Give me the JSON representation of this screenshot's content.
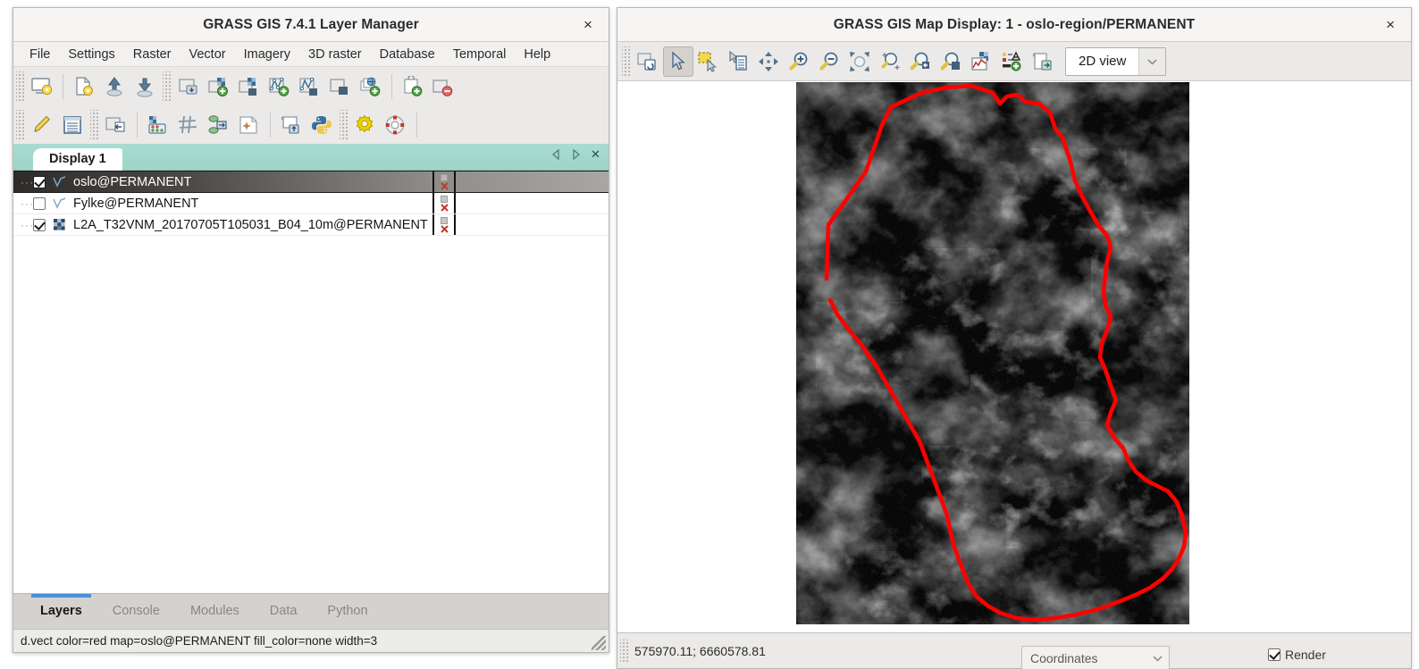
{
  "layer_manager": {
    "title": "GRASS GIS 7.4.1 Layer Manager",
    "close_label": "×",
    "menu": [
      "File",
      "Settings",
      "Raster",
      "Vector",
      "Imagery",
      "3D raster",
      "Database",
      "Temporal",
      "Help"
    ],
    "toolbar_row1": [
      {
        "name": "start-new-map-display-icon",
        "tip": "Start new map display"
      },
      {
        "name": "create-new-workspace-icon",
        "tip": "Create new workspace"
      },
      {
        "name": "open-existing-workspace-icon",
        "tip": "Open existing workspace file"
      },
      {
        "name": "save-workspace-icon",
        "tip": "Save current workspace to file"
      },
      {
        "name": "import-raster-data-icon",
        "tip": "Import raster data"
      },
      {
        "name": "add-raster-layer-icon",
        "tip": "Add raster map layer"
      },
      {
        "name": "add-various-raster-layers-icon",
        "tip": "Add various raster map layers"
      },
      {
        "name": "add-vector-layer-icon",
        "tip": "Add vector map layer"
      },
      {
        "name": "add-various-vector-layers-icon",
        "tip": "Add various vector map layers"
      },
      {
        "name": "add-web-service-layer-icon",
        "tip": "Add group"
      },
      {
        "name": "add-group-icon",
        "tip": "Add group"
      },
      {
        "name": "add-command-layer-icon",
        "tip": "Add command layer"
      },
      {
        "name": "remove-layer-icon",
        "tip": "Remove selected map layer"
      }
    ],
    "toolbar_row2": [
      {
        "name": "edit-vector-maps-icon",
        "tip": "Edit vector maps"
      },
      {
        "name": "show-attribute-table-icon",
        "tip": "Show attribute data"
      },
      {
        "name": "raster-map-calculator-icon",
        "tip": "Raster map calculator"
      },
      {
        "name": "georectifier-icon",
        "tip": "Georectifier"
      },
      {
        "name": "graphical-modeler-icon",
        "tip": "Graphical modeler"
      },
      {
        "name": "cartographic-composer-icon",
        "tip": "Cartographic composer"
      },
      {
        "name": "launch-script-icon",
        "tip": "Launch script"
      },
      {
        "name": "python-shell-icon",
        "tip": "Open a simple Python code editor"
      },
      {
        "name": "settings-icon",
        "tip": "Show GUI settings"
      },
      {
        "name": "help-icon",
        "tip": "Show help"
      }
    ],
    "display_tab": {
      "label": "Display 1",
      "controls": [
        {
          "name": "prev-display-icon",
          "glyph": "◁"
        },
        {
          "name": "next-display-icon",
          "glyph": "▷"
        },
        {
          "name": "close-display-icon",
          "glyph": "✕"
        }
      ]
    },
    "layers": [
      {
        "name": "oslo@PERMANENT",
        "type": "vector",
        "checked": true,
        "selected": true
      },
      {
        "name": "Fylke@PERMANENT",
        "type": "vector",
        "checked": false,
        "selected": false
      },
      {
        "name": "L2A_T32VNM_20170705T105031_B04_10m@PERMANENT",
        "type": "raster",
        "checked": true,
        "selected": false
      }
    ],
    "bottom_tabs": [
      {
        "label": "Layers",
        "active": true
      },
      {
        "label": "Console",
        "active": false
      },
      {
        "label": "Modules",
        "active": false
      },
      {
        "label": "Data",
        "active": false
      },
      {
        "label": "Python",
        "active": false
      }
    ],
    "status_text": "d.vect color=red map=oslo@PERMANENT fill_color=none width=3"
  },
  "map_display": {
    "title": "GRASS GIS Map Display: 1 - oslo-region/PERMANENT",
    "close_label": "×",
    "toolbar": [
      {
        "name": "display-map-icon",
        "tip": "Render map",
        "active": false
      },
      {
        "name": "pointer-icon",
        "tip": "Pointer",
        "active": true
      },
      {
        "name": "select-features-icon",
        "tip": "Select features",
        "active": false
      },
      {
        "name": "query-raster-vector-icon",
        "tip": "Query raster/vector map(s)",
        "active": false
      },
      {
        "name": "pan-icon",
        "tip": "Pan",
        "active": false
      },
      {
        "name": "zoom-in-icon",
        "tip": "Zoom in",
        "active": false
      },
      {
        "name": "zoom-out-icon",
        "tip": "Zoom out",
        "active": false
      },
      {
        "name": "zoom-to-selected-icon",
        "tip": "Various zoom options",
        "active": false
      },
      {
        "name": "zoom-to-computational-region-icon",
        "tip": "Zoom to computational region extent",
        "active": false
      },
      {
        "name": "zoom-back-icon",
        "tip": "Return to previous zoom",
        "active": false
      },
      {
        "name": "zoom-to-map-icon",
        "tip": "Zoom to selected map layer",
        "active": false
      },
      {
        "name": "analyze-map-icon",
        "tip": "Analyze map",
        "active": false
      },
      {
        "name": "add-map-elements-icon",
        "tip": "Add map elements",
        "active": false
      },
      {
        "name": "save-display-to-file-icon",
        "tip": "Save display to file",
        "active": false
      }
    ],
    "view_select": {
      "value": "2D view",
      "arrow": "▾"
    },
    "status": {
      "coordinates": "575970.11; 6660578.81",
      "mode_value": "Coordinates",
      "mode_arrow": "▾",
      "render_label": "Render",
      "render_checked": true
    },
    "map": {
      "vector_outline_color": "#ff0000",
      "vector_outline_width": 3,
      "raster_palette": "greyscale"
    }
  },
  "colors": {
    "tab_accent": "#4a90d9",
    "display_tabbar": "#a8dcd0",
    "vector_icon": "#3b6f96",
    "raster_icon_dark": "#2f4a63",
    "window_bg": "#f2f1f0"
  }
}
